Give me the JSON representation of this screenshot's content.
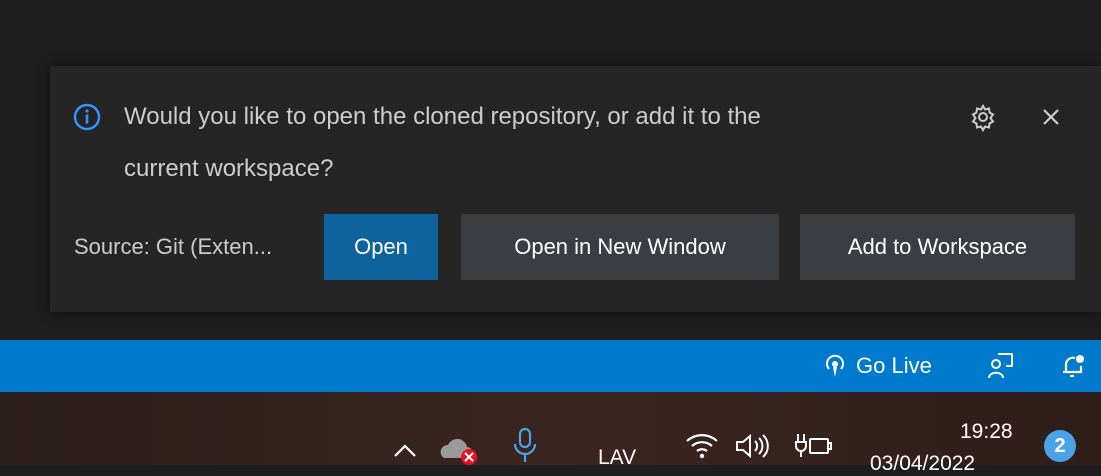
{
  "notification": {
    "message_line1": "Would you like to open the cloned repository, or add it to the",
    "message_line2": "current workspace?",
    "source": "Source: Git (Exten...",
    "buttons": {
      "open": "Open",
      "open_new_window": "Open in New Window",
      "add_workspace": "Add to Workspace"
    },
    "icons": {
      "info": "info-icon",
      "gear": "gear-icon",
      "close": "close-icon"
    }
  },
  "statusbar": {
    "go_live": "Go Live",
    "icons": {
      "broadcast": "broadcast-icon",
      "feedback": "feedback-icon",
      "bell": "bell-icon"
    },
    "color": "#007acc"
  },
  "taskbar": {
    "language": "LAV",
    "time": "19:28",
    "date": "03/04/2022",
    "notification_count": "2"
  },
  "colors": {
    "primary_button": "#0e639c",
    "secondary_button": "#3a3d41",
    "toast_bg": "#252526",
    "info_accent": "#3794ff"
  }
}
